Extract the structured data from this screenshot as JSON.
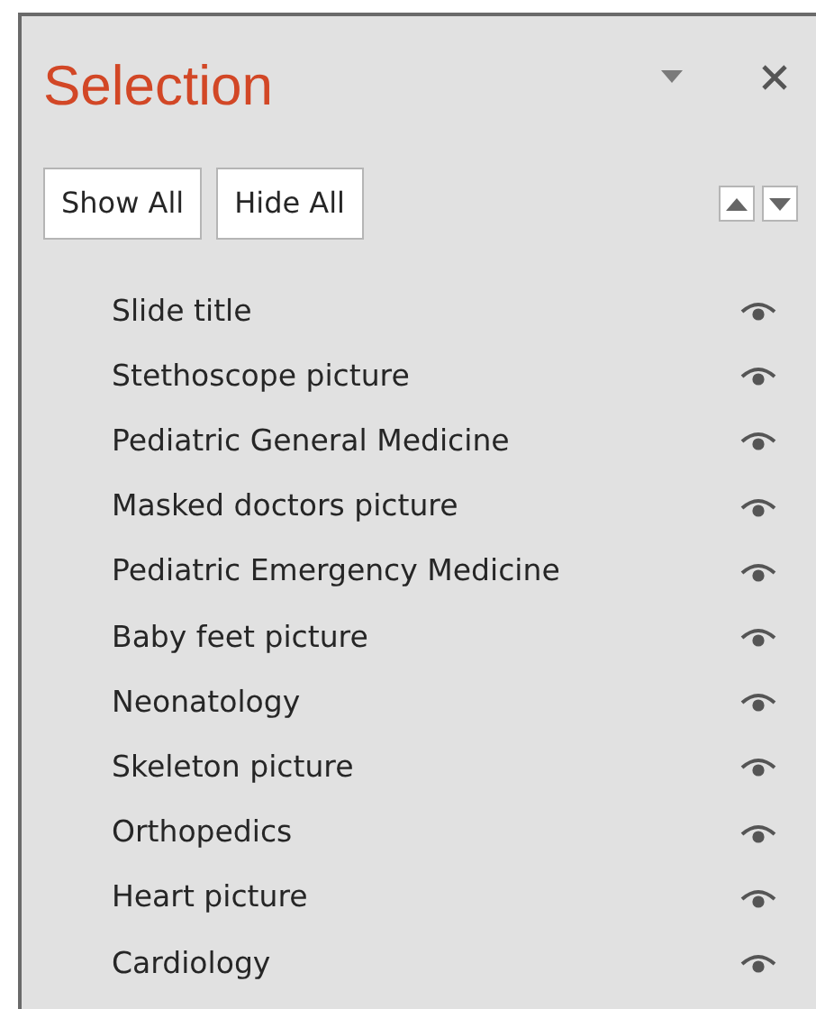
{
  "pane": {
    "title": "Selection"
  },
  "buttons": [
    "Show All",
    "Hide All"
  ],
  "items": [
    {
      "name": "Slide title",
      "visible": true
    },
    {
      "name": "Stethoscope picture",
      "visible": true
    },
    {
      "name": "Pediatric General Medicine",
      "visible": true
    },
    {
      "name": "Masked doctors picture",
      "visible": true
    },
    {
      "name": "Pediatric Emergency Medicine",
      "visible": true
    },
    {
      "name": "Baby feet picture",
      "visible": true
    },
    {
      "name": "Neonatology",
      "visible": true
    },
    {
      "name": "Skeleton picture",
      "visible": true
    },
    {
      "name": "Orthopedics",
      "visible": true
    },
    {
      "name": "Heart picture",
      "visible": true
    },
    {
      "name": "Cardiology",
      "visible": true
    }
  ]
}
